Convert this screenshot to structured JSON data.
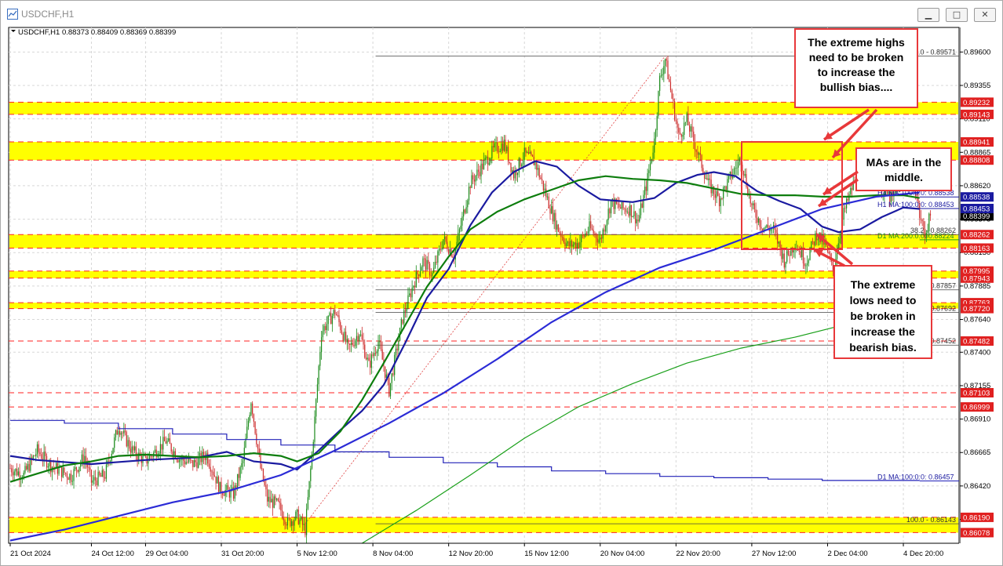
{
  "window": {
    "title": "USDCHF,H1",
    "buttons": [
      "▁",
      "□",
      "✕"
    ]
  },
  "chart_data": {
    "type": "candlestick",
    "title": "USDCHF,H1",
    "ohlc_header": "USDCHF,H1  0.88373 0.88409 0.88369 0.88399",
    "ylim": [
      0.86,
      0.8978
    ],
    "y_ticks": [
      0.896,
      0.89355,
      0.8911,
      0.88865,
      0.8862,
      0.88375,
      0.8813,
      0.87885,
      0.8764,
      0.874,
      0.87155,
      0.8691,
      0.86665,
      0.8642,
      0.86175
    ],
    "y_tick_labels": [
      "0.89600",
      "0.89355",
      "0.89110",
      "0.88865",
      "0.88620",
      "0.88375",
      "0.88130",
      "0.87885",
      "0.87640",
      "0.87400",
      "0.87155",
      "0.86910",
      "0.86665",
      "0.86420",
      "0.86175"
    ],
    "x_ticks": [
      {
        "t": 0,
        "label": "21 Oct 2024"
      },
      {
        "t": 60,
        "label": "24 Oct 12:00"
      },
      {
        "t": 100,
        "label": "29 Oct 04:00"
      },
      {
        "t": 156,
        "label": "31 Oct 20:00"
      },
      {
        "t": 212,
        "label": "5 Nov 12:00"
      },
      {
        "t": 268,
        "label": "8 Nov 04:00"
      },
      {
        "t": 324,
        "label": "12 Nov 20:00"
      },
      {
        "t": 380,
        "label": "15 Nov 12:00"
      },
      {
        "t": 436,
        "label": "20 Nov 04:00"
      },
      {
        "t": 492,
        "label": "22 Nov 20:00"
      },
      {
        "t": 548,
        "label": "27 Nov 12:00"
      },
      {
        "t": 604,
        "label": "2 Dec 04:00"
      },
      {
        "t": 660,
        "label": "4 Dec 20:00"
      }
    ],
    "price_path": [
      [
        0,
        0.8655
      ],
      [
        10,
        0.865
      ],
      [
        20,
        0.8668
      ],
      [
        30,
        0.8657
      ],
      [
        45,
        0.8649
      ],
      [
        55,
        0.8664
      ],
      [
        60,
        0.8645
      ],
      [
        70,
        0.865
      ],
      [
        80,
        0.8686
      ],
      [
        90,
        0.8668
      ],
      [
        100,
        0.866
      ],
      [
        115,
        0.8675
      ],
      [
        125,
        0.8662
      ],
      [
        135,
        0.8658
      ],
      [
        145,
        0.8665
      ],
      [
        155,
        0.864
      ],
      [
        165,
        0.8636
      ],
      [
        172,
        0.866
      ],
      [
        178,
        0.8705
      ],
      [
        185,
        0.8655
      ],
      [
        190,
        0.8632
      ],
      [
        198,
        0.8628
      ],
      [
        205,
        0.8615
      ],
      [
        212,
        0.862
      ],
      [
        218,
        0.861
      ],
      [
        223,
        0.8665
      ],
      [
        230,
        0.8755
      ],
      [
        240,
        0.877
      ],
      [
        250,
        0.8742
      ],
      [
        258,
        0.8755
      ],
      [
        265,
        0.873
      ],
      [
        272,
        0.8748
      ],
      [
        280,
        0.8712
      ],
      [
        290,
        0.8765
      ],
      [
        298,
        0.879
      ],
      [
        305,
        0.8807
      ],
      [
        312,
        0.8797
      ],
      [
        320,
        0.8823
      ],
      [
        328,
        0.8811
      ],
      [
        340,
        0.8864
      ],
      [
        350,
        0.8878
      ],
      [
        358,
        0.8889
      ],
      [
        365,
        0.8893
      ],
      [
        372,
        0.887
      ],
      [
        380,
        0.8885
      ],
      [
        388,
        0.8879
      ],
      [
        396,
        0.8855
      ],
      [
        404,
        0.8832
      ],
      [
        412,
        0.8818
      ],
      [
        420,
        0.882
      ],
      [
        428,
        0.8831
      ],
      [
        436,
        0.8822
      ],
      [
        444,
        0.885
      ],
      [
        452,
        0.8845
      ],
      [
        458,
        0.8845
      ],
      [
        464,
        0.8836
      ],
      [
        470,
        0.8862
      ],
      [
        476,
        0.8895
      ],
      [
        480,
        0.894
      ],
      [
        484,
        0.8955
      ],
      [
        488,
        0.8932
      ],
      [
        494,
        0.8898
      ],
      [
        500,
        0.891
      ],
      [
        508,
        0.8886
      ],
      [
        516,
        0.8863
      ],
      [
        524,
        0.8852
      ],
      [
        532,
        0.8868
      ],
      [
        540,
        0.8882
      ],
      [
        548,
        0.8846
      ],
      [
        556,
        0.8832
      ],
      [
        564,
        0.883
      ],
      [
        572,
        0.8807
      ],
      [
        580,
        0.882
      ],
      [
        588,
        0.8806
      ],
      [
        596,
        0.8827
      ],
      [
        602,
        0.8819
      ],
      [
        608,
        0.88
      ],
      [
        616,
        0.8842
      ],
      [
        622,
        0.886
      ],
      [
        628,
        0.8875
      ],
      [
        636,
        0.8878
      ],
      [
        644,
        0.8859
      ],
      [
        652,
        0.8852
      ],
      [
        660,
        0.887
      ],
      [
        668,
        0.8865
      ],
      [
        672,
        0.884
      ],
      [
        676,
        0.8826
      ],
      [
        680,
        0.884
      ]
    ],
    "ma_series": [
      {
        "name": "H1 MA:100:0:0: 0.88453",
        "color": "#1a1aa0",
        "points": [
          [
            0,
            0.8664
          ],
          [
            20,
            0.8661
          ],
          [
            60,
            0.8658
          ],
          [
            100,
            0.8661
          ],
          [
            140,
            0.8663
          ],
          [
            160,
            0.8667
          ],
          [
            180,
            0.866
          ],
          [
            200,
            0.8658
          ],
          [
            212,
            0.8654
          ],
          [
            228,
            0.8668
          ],
          [
            244,
            0.8683
          ],
          [
            260,
            0.8697
          ],
          [
            276,
            0.8716
          ],
          [
            292,
            0.8747
          ],
          [
            308,
            0.878
          ],
          [
            324,
            0.8801
          ],
          [
            340,
            0.8833
          ],
          [
            356,
            0.8857
          ],
          [
            372,
            0.8872
          ],
          [
            388,
            0.888
          ],
          [
            404,
            0.8876
          ],
          [
            420,
            0.8862
          ],
          [
            436,
            0.8852
          ],
          [
            448,
            0.8851
          ],
          [
            460,
            0.885
          ],
          [
            476,
            0.8853
          ],
          [
            492,
            0.8864
          ],
          [
            508,
            0.887
          ],
          [
            520,
            0.8872
          ],
          [
            536,
            0.8869
          ],
          [
            552,
            0.8858
          ],
          [
            568,
            0.8851
          ],
          [
            584,
            0.8845
          ],
          [
            600,
            0.8832
          ],
          [
            612,
            0.8828
          ],
          [
            628,
            0.883
          ],
          [
            644,
            0.8839
          ],
          [
            660,
            0.8846
          ],
          [
            672,
            0.8845
          ]
        ]
      },
      {
        "name": "H4 MA:100:0:0: 0.88538",
        "color": "#0d7d0d",
        "points": [
          [
            0,
            0.8645
          ],
          [
            20,
            0.8651
          ],
          [
            40,
            0.8657
          ],
          [
            60,
            0.866
          ],
          [
            80,
            0.8664
          ],
          [
            100,
            0.8665
          ],
          [
            120,
            0.8664
          ],
          [
            140,
            0.8663
          ],
          [
            160,
            0.8664
          ],
          [
            180,
            0.8666
          ],
          [
            200,
            0.8664
          ],
          [
            212,
            0.866
          ],
          [
            228,
            0.8666
          ],
          [
            244,
            0.8682
          ],
          [
            260,
            0.8705
          ],
          [
            276,
            0.8732
          ],
          [
            292,
            0.876
          ],
          [
            308,
            0.8788
          ],
          [
            324,
            0.881
          ],
          [
            340,
            0.883
          ],
          [
            360,
            0.8843
          ],
          [
            380,
            0.8852
          ],
          [
            400,
            0.8859
          ],
          [
            420,
            0.8866
          ],
          [
            440,
            0.8869
          ],
          [
            460,
            0.8867
          ],
          [
            480,
            0.8866
          ],
          [
            500,
            0.8864
          ],
          [
            520,
            0.886
          ],
          [
            540,
            0.8856
          ],
          [
            560,
            0.8855
          ],
          [
            580,
            0.8855
          ],
          [
            600,
            0.8854
          ],
          [
            620,
            0.8854
          ],
          [
            640,
            0.8855
          ],
          [
            660,
            0.8855
          ],
          [
            672,
            0.8853
          ]
        ]
      },
      {
        "name": "H1 MA:200",
        "color": "#2b2bd6",
        "points": [
          [
            0,
            0.8602
          ],
          [
            40,
            0.861
          ],
          [
            80,
            0.862
          ],
          [
            120,
            0.863
          ],
          [
            160,
            0.8638
          ],
          [
            200,
            0.865
          ],
          [
            240,
            0.8668
          ],
          [
            280,
            0.8688
          ],
          [
            320,
            0.871
          ],
          [
            360,
            0.8735
          ],
          [
            400,
            0.8762
          ],
          [
            440,
            0.8784
          ],
          [
            480,
            0.8802
          ],
          [
            520,
            0.8815
          ],
          [
            560,
            0.883
          ],
          [
            600,
            0.8845
          ],
          [
            640,
            0.8854
          ],
          [
            672,
            0.8857
          ]
        ]
      },
      {
        "name": "D1 MA:100:0:0: 0.86457",
        "color": "#2020b8",
        "stepped": true,
        "points": [
          [
            0,
            0.869
          ],
          [
            40,
            0.8688
          ],
          [
            80,
            0.8684
          ],
          [
            120,
            0.868
          ],
          [
            160,
            0.8676
          ],
          [
            200,
            0.8672
          ],
          [
            240,
            0.8667
          ],
          [
            280,
            0.8663
          ],
          [
            320,
            0.8659
          ],
          [
            360,
            0.8656
          ],
          [
            400,
            0.8653
          ],
          [
            440,
            0.8651
          ],
          [
            480,
            0.8649
          ],
          [
            520,
            0.8648
          ],
          [
            560,
            0.8647
          ],
          [
            600,
            0.8646
          ],
          [
            640,
            0.8646
          ],
          [
            672,
            0.8646
          ]
        ]
      },
      {
        "name": "D1 MA:200:0:0: 0.88224",
        "color": "#1aa01a",
        "points": [
          [
            260,
            0.86
          ],
          [
            300,
            0.8624
          ],
          [
            340,
            0.865
          ],
          [
            380,
            0.8677
          ],
          [
            420,
            0.87
          ],
          [
            460,
            0.8717
          ],
          [
            500,
            0.8732
          ],
          [
            540,
            0.8743
          ],
          [
            580,
            0.8751
          ],
          [
            620,
            0.8761
          ],
          [
            660,
            0.8768
          ],
          [
            680,
            0.8769
          ]
        ]
      }
    ],
    "zones": [
      {
        "from": 0.89143,
        "to": 0.89232
      },
      {
        "from": 0.88808,
        "to": 0.88941
      },
      {
        "from": 0.88163,
        "to": 0.88262
      },
      {
        "from": 0.87943,
        "to": 0.87995
      },
      {
        "from": 0.8772,
        "to": 0.87763
      },
      {
        "from": 0.86078,
        "to": 0.8619
      }
    ],
    "right_labels": [
      {
        "price": 0.89232,
        "text": "0.89232",
        "bg": "#e02020"
      },
      {
        "price": 0.89143,
        "text": "0.89143",
        "bg": "#e02020"
      },
      {
        "price": 0.88941,
        "text": "0.88941",
        "bg": "#e02020"
      },
      {
        "price": 0.88808,
        "text": "0.88808",
        "bg": "#e02020"
      },
      {
        "price": 0.88399,
        "text": "0.88399",
        "bg": "#000000"
      },
      {
        "price": 0.88262,
        "text": "0.88262",
        "bg": "#e02020"
      },
      {
        "price": 0.88163,
        "text": "0.88163",
        "bg": "#e02020"
      },
      {
        "price": 0.87995,
        "text": "0.87995",
        "bg": "#e02020"
      },
      {
        "price": 0.87943,
        "text": "0.87943",
        "bg": "#e02020"
      },
      {
        "price": 0.87763,
        "text": "0.87763",
        "bg": "#e02020"
      },
      {
        "price": 0.8772,
        "text": "0.87720",
        "bg": "#e02020"
      },
      {
        "price": 0.87482,
        "text": "0.87482",
        "bg": "#e02020"
      },
      {
        "price": 0.87103,
        "text": "0.87103",
        "bg": "#e02020"
      },
      {
        "price": 0.86999,
        "text": "0.86999",
        "bg": "#e02020"
      },
      {
        "price": 0.8619,
        "text": "0.86190",
        "bg": "#e02020"
      },
      {
        "price": 0.86078,
        "text": "0.86078",
        "bg": "#e02020"
      }
    ],
    "ma_value_labels": [
      {
        "price": 0.88538,
        "text": "0.88538",
        "bg": "#1a1aa0"
      },
      {
        "price": 0.88453,
        "text": "0.88453",
        "bg": "#1a1aa0"
      }
    ],
    "fib_levels": [
      {
        "price": 0.89571,
        "text": "0.0 - 0.89571"
      },
      {
        "price": 0.88262,
        "text": "38.2 - 0.88262"
      },
      {
        "price": 0.87857,
        "text": "0.87857"
      },
      {
        "price": 0.87692,
        "text": "0.87692"
      },
      {
        "price": 0.87452,
        "text": "0.87452"
      },
      {
        "price": 0.86143,
        "text": "100.0 - 0.86143"
      }
    ],
    "ma_labels": [
      "H4 MA:100:0:0: 0.88538",
      "H1 MA:100:0:0: 0.88453",
      "D1 MA:200:0:0: 0.88224",
      "D1 MA:100:0:0: 0.86457"
    ],
    "annotations": [
      {
        "lines": [
          "The extreme highs",
          "need to be broken",
          "to increase the",
          "bullish bias...."
        ]
      },
      {
        "lines": [
          "MAs are in the",
          "middle."
        ]
      },
      {
        "lines": [
          "The extreme",
          "lows need to",
          "be broken in",
          "increase the",
          "bearish bias."
        ]
      }
    ],
    "colors": {
      "zone": "#ffff00",
      "zone_border": "#ff2020",
      "bull": "#1a8a1a",
      "bear": "#cc2a2a",
      "annotation": "#e8383a"
    }
  }
}
